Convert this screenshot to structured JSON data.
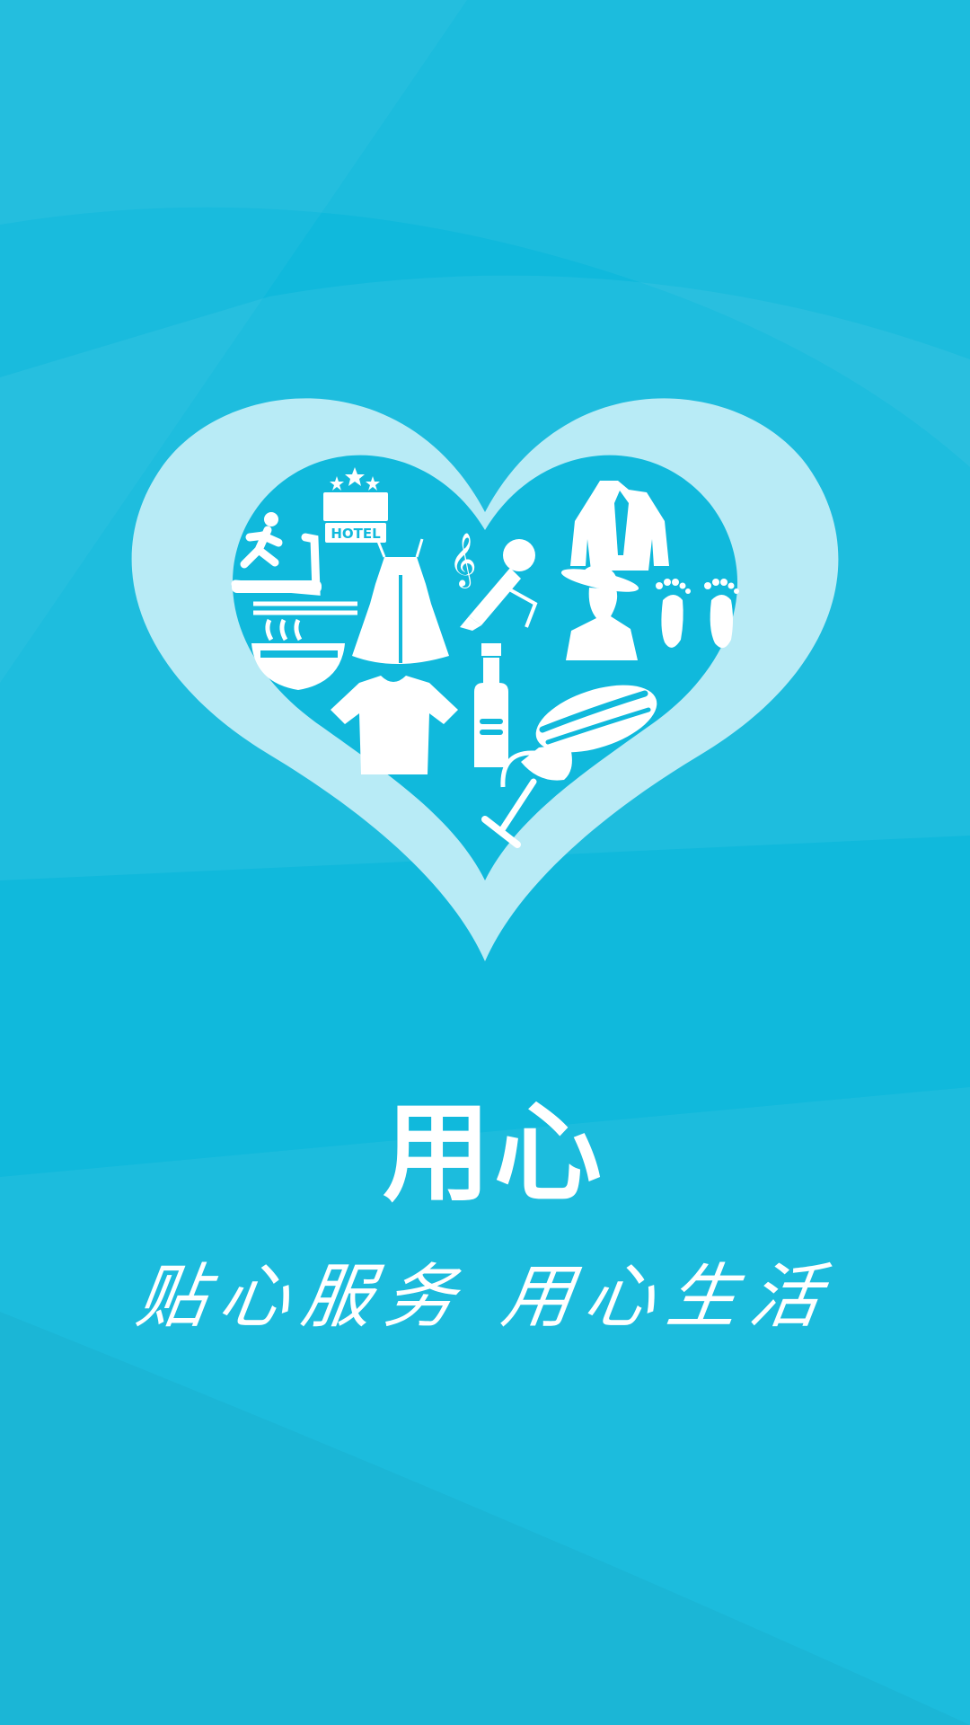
{
  "splash": {
    "brand_text": "用心",
    "slogan_text": "贴心服务 用心生活",
    "hotel_sign": "HOTEL",
    "music_note": "𝄞",
    "icons": [
      "hotel-icon",
      "treadmill-icon",
      "noodle-bowl-icon",
      "dress-icon",
      "treble-clef-icon",
      "microphone-icon",
      "shirt-tie-icon",
      "cowboy-icon",
      "footprints-icon",
      "tshirt-icon",
      "bottle-icon",
      "hotdog-icon",
      "wine-glass-icon"
    ]
  },
  "colors": {
    "background": "#10b9dc",
    "heart_outer": "#b8ebf6",
    "heart_inner": "#10b9dc",
    "icon": "#ffffff"
  }
}
